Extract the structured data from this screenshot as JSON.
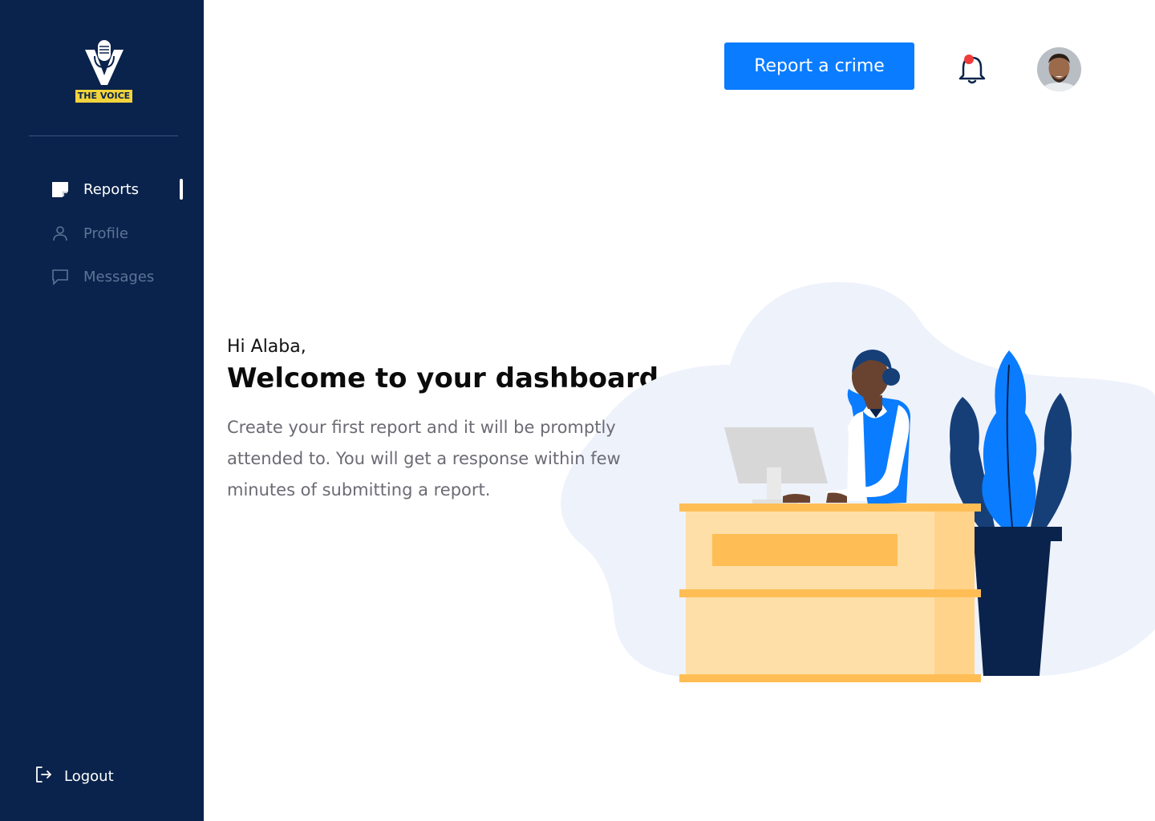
{
  "brand": {
    "name": "THE VOICE",
    "badge_color": "#f2d33c",
    "sidebar_color": "#0a234c"
  },
  "sidebar": {
    "items": [
      {
        "label": "Reports",
        "icon": "note-icon",
        "active": true
      },
      {
        "label": "Profile",
        "icon": "user-icon",
        "active": false
      },
      {
        "label": "Messages",
        "icon": "message-icon",
        "active": false
      }
    ],
    "logout_label": "Logout"
  },
  "header": {
    "cta_label": "Report a crime",
    "cta_color": "#0a7cff",
    "notification_icon": "bell-icon",
    "has_unread_notification": true
  },
  "main": {
    "greeting": "Hi Alaba,",
    "title": "Welcome to your dashboard",
    "description": "Create your first report and it will be promptly attended to. You will get a response within few minutes of submitting a report."
  }
}
